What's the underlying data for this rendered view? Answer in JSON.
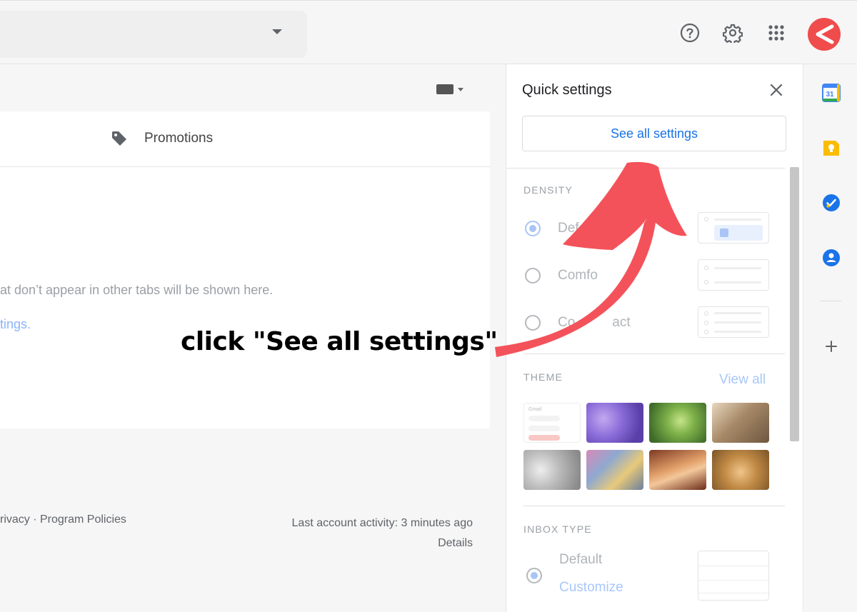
{
  "header": {
    "search_caret_icon": "chevron-down-icon",
    "icons": [
      "help-icon",
      "gear-icon",
      "apps-grid-icon"
    ],
    "avatar_color": "#f04c4c"
  },
  "main": {
    "tab_label": "Promotions",
    "empty_message": "at don’t appear in other tabs will be shown here.",
    "empty_link": "tings.",
    "footer_left": "rivacy · Program Policies",
    "footer_activity": "Last account activity: 3 minutes ago",
    "footer_details": "Details"
  },
  "quick_settings": {
    "title": "Quick settings",
    "see_all_label": "See all settings",
    "density": {
      "heading": "DENSITY",
      "options": [
        {
          "label": "Default",
          "visible_text": "Def",
          "selected": true
        },
        {
          "label": "Comfortable",
          "visible_text": "Comfo",
          "selected": false
        },
        {
          "label": "Compact",
          "visible_text": "Co",
          "suffix": "act",
          "selected": false
        }
      ]
    },
    "theme": {
      "heading": "THEME",
      "view_all": "View all",
      "preview_brand": "Gmail"
    },
    "inbox_type": {
      "heading": "INBOX TYPE",
      "default_label": "Default",
      "customize_label": "Customize"
    }
  },
  "annotation": {
    "text": "click \"See all settings\"",
    "arrow_color": "#f4525a"
  },
  "colors": {
    "accent": "#1a73e8",
    "faded_accent": "#a8c7fa"
  }
}
